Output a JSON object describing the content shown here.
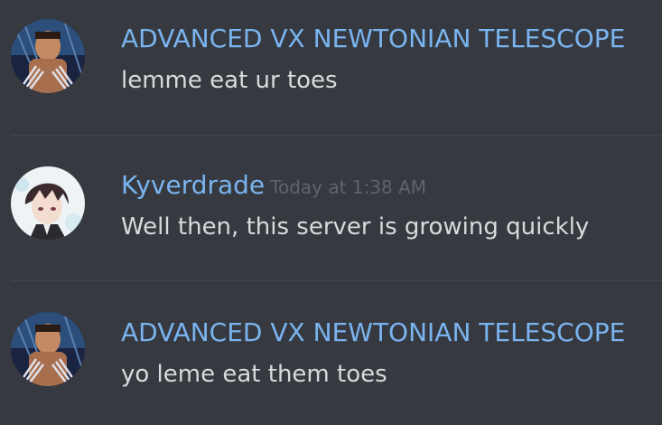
{
  "messages": [
    {
      "author": "ADVANCED VX NEWTONIAN TELESCOPE",
      "timestamp": "",
      "text": "lemme eat ur toes",
      "avatar_icon": "wolverine-avatar-icon"
    },
    {
      "author": "Kyverdrade",
      "timestamp": "Today at 1:38 AM",
      "text": "Well then, this server is growing quickly",
      "avatar_icon": "anime-character-avatar-icon"
    },
    {
      "author": "ADVANCED VX NEWTONIAN TELESCOPE",
      "timestamp": "",
      "text": "yo leme eat them toes",
      "avatar_icon": "wolverine-avatar-icon"
    }
  ],
  "colors": {
    "background": "#36393f",
    "username": "#7ab4f0",
    "text": "#d9dadc",
    "timestamp": "#5f646c",
    "divider": "#44474e"
  }
}
